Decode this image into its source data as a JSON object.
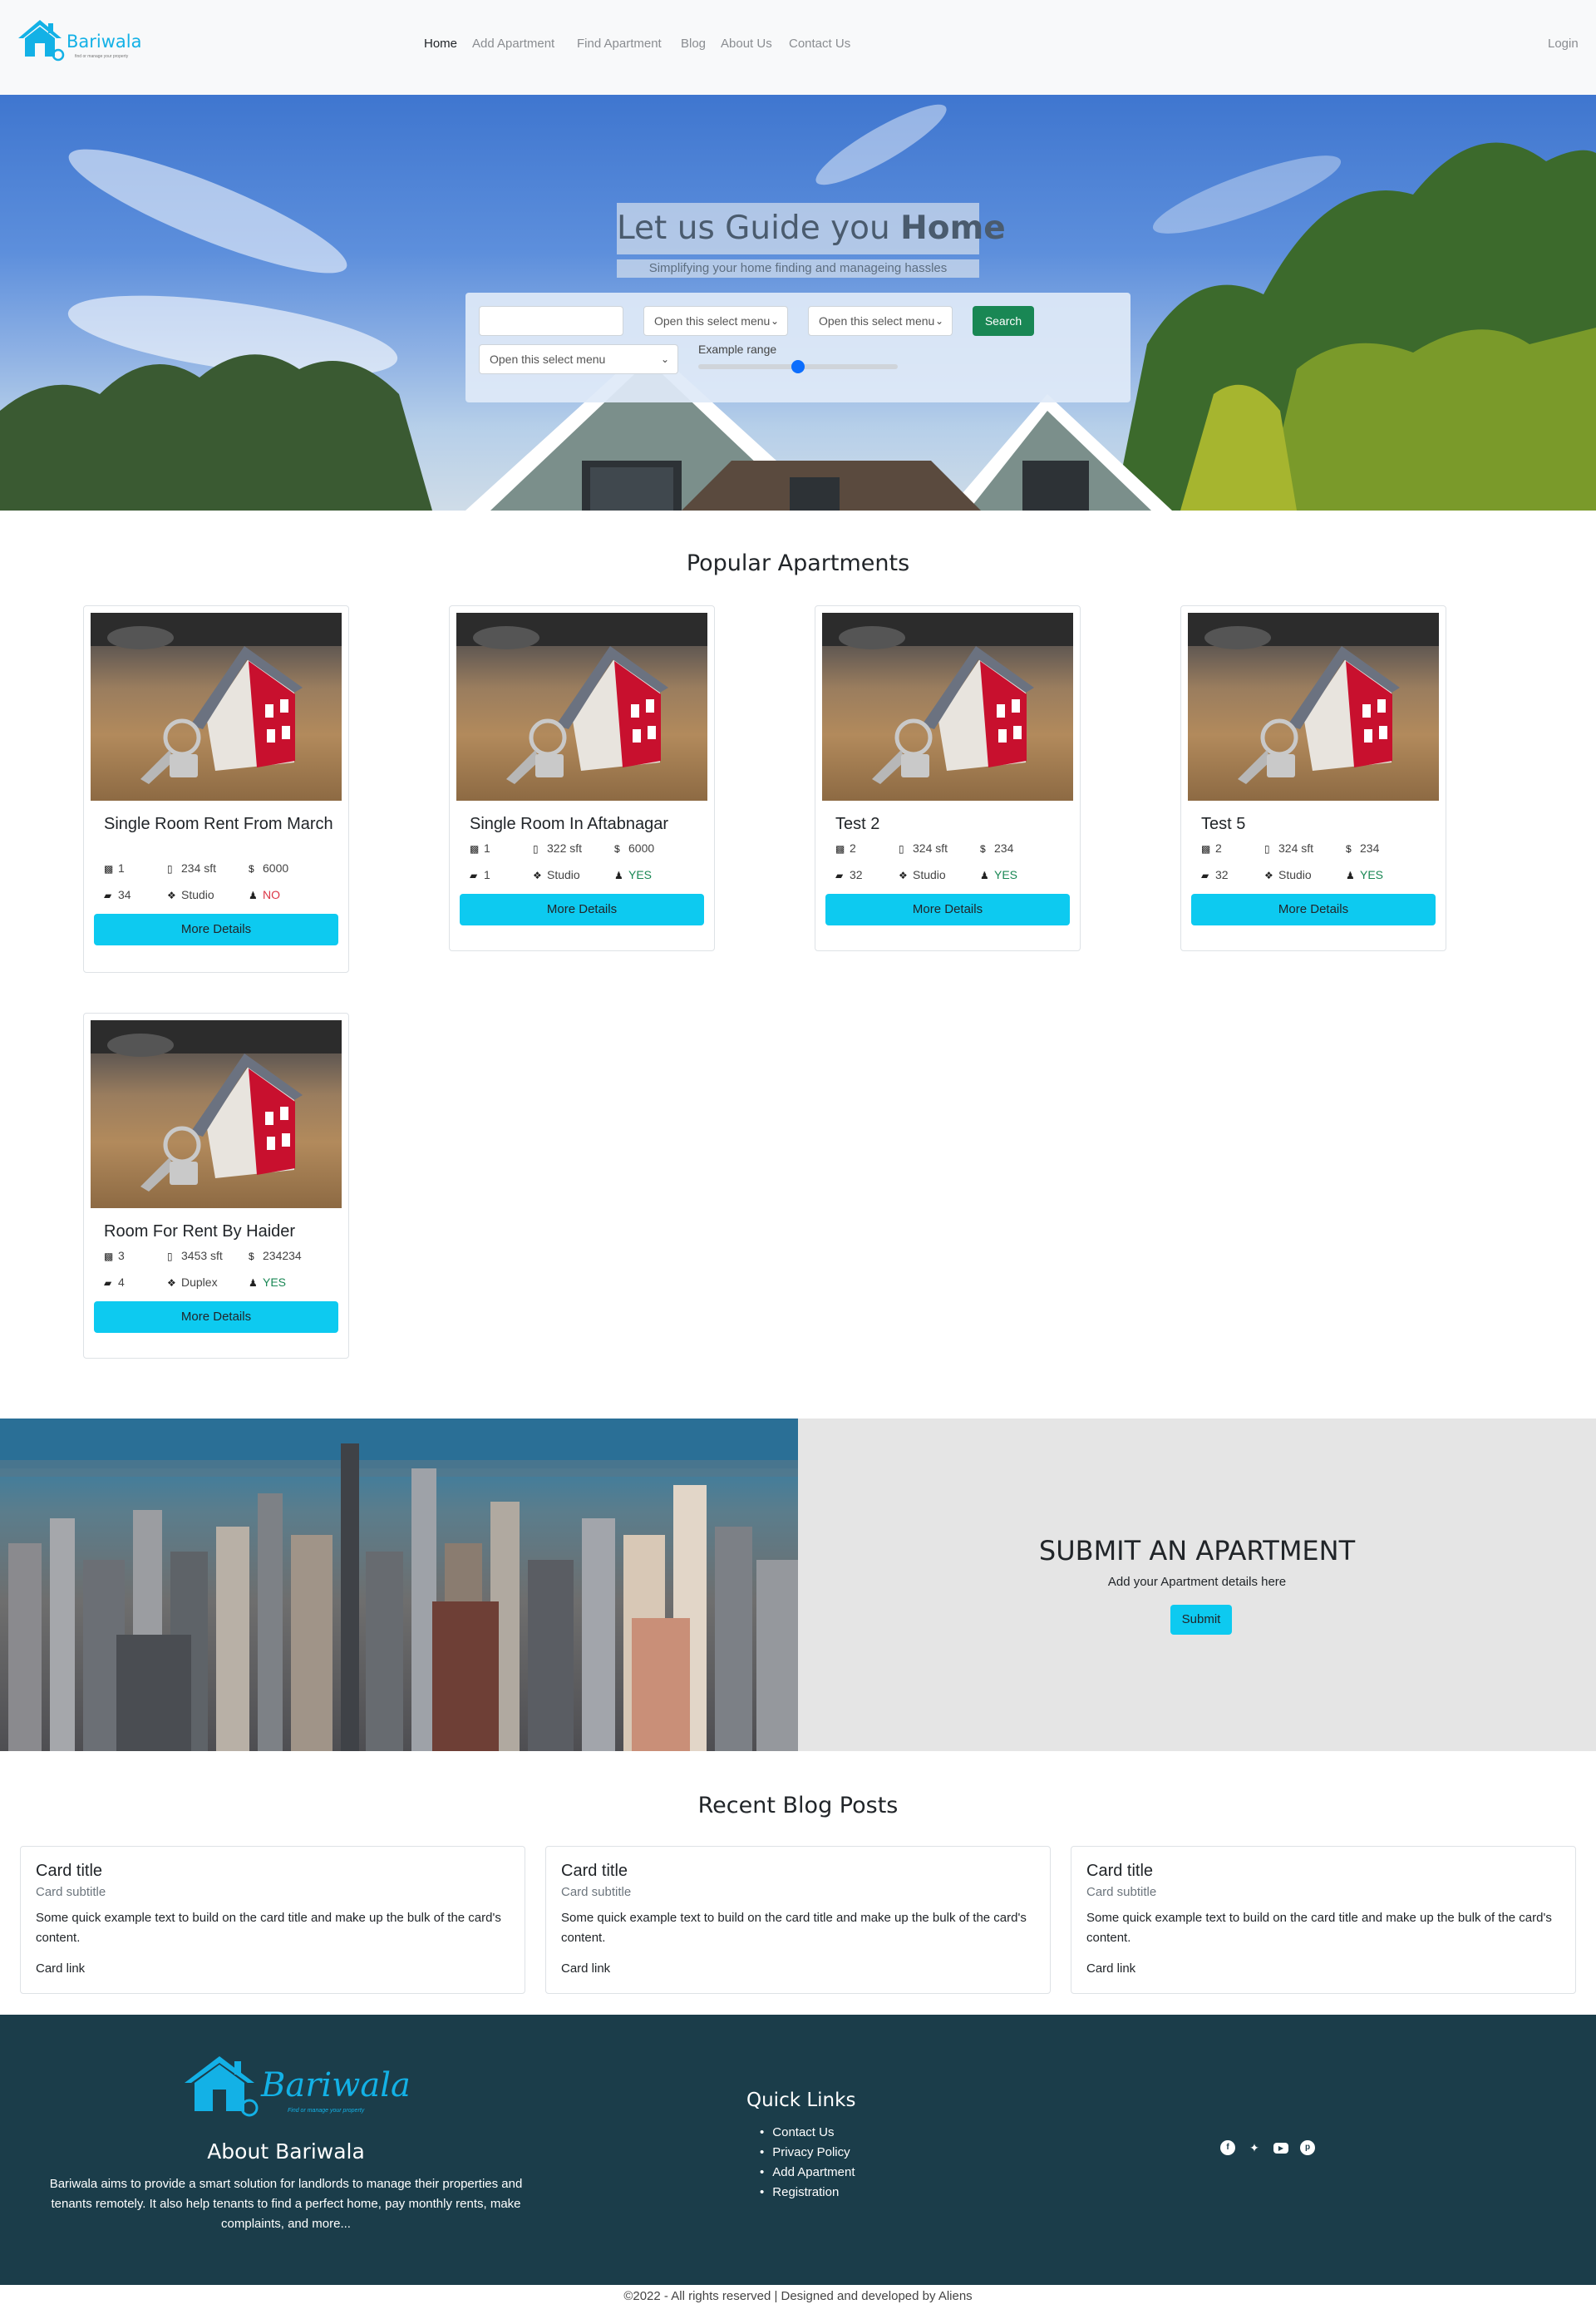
{
  "navbar": {
    "brand": "Bariwala",
    "brand_tagline": "find or manage your property",
    "links": [
      "Home",
      "Add Apartment",
      "Find Apartment",
      "Blog",
      "About Us",
      "Contact Us"
    ],
    "active_link": "Home",
    "login": "Login",
    "logo_icon": "house-icon"
  },
  "hero": {
    "title_main": "Let us Guide you ",
    "title_bold": "Home",
    "subtitle": "Simplifying your home finding and manageing hassles",
    "search": {
      "text_value": "",
      "select1": "Open this select menu",
      "select2": "Open this select menu",
      "select3": "Open this select menu",
      "button": "Search",
      "range_label": "Example range",
      "range_value_fraction": 0.5
    }
  },
  "popular": {
    "title": "Popular Apartments",
    "cards": [
      {
        "title": "Single Room Rent From March",
        "beds": "1",
        "area": "234 sft",
        "price": "6000",
        "baths": "34",
        "type": "Studio",
        "available": "NO"
      },
      {
        "title": "Single Room In Aftabnagar",
        "beds": "1",
        "area": "322 sft",
        "price": "6000",
        "baths": "1",
        "type": "Studio",
        "available": "YES"
      },
      {
        "title": "Test 2",
        "beds": "2",
        "area": "324 sft",
        "price": "234",
        "baths": "32",
        "type": "Studio",
        "available": "YES"
      },
      {
        "title": "Test 5",
        "beds": "2",
        "area": "324 sft",
        "price": "234",
        "baths": "32",
        "type": "Studio",
        "available": "YES"
      },
      {
        "title": "Room For Rent By Haider",
        "beds": "3",
        "area": "3453 sft",
        "price": "234234",
        "baths": "4",
        "type": "Duplex",
        "available": "YES"
      }
    ],
    "more_button": "More Details"
  },
  "submit": {
    "title": "SUBMIT AN APARTMENT",
    "subtitle": "Add your Apartment details here",
    "button": "Submit"
  },
  "blog": {
    "title": "Recent Blog Posts",
    "cards": [
      {
        "title": "Card title",
        "subtitle": "Card subtitle",
        "text": "Some quick example text to build on the card title and make up the bulk of the card's content.",
        "link": "Card link"
      },
      {
        "title": "Card title",
        "subtitle": "Card subtitle",
        "text": "Some quick example text to build on the card title and make up the bulk of the card's content.",
        "link": "Card link"
      },
      {
        "title": "Card title",
        "subtitle": "Card subtitle",
        "text": "Some quick example text to build on the card title and make up the bulk of the card's content.",
        "link": "Card link"
      }
    ]
  },
  "footer": {
    "logo": "Bariwala",
    "logo_tagline": "Find or manage your property",
    "about_title": "About Bariwala",
    "about_text": "Bariwala aims to provide a smart solution for landlords to manage their properties and tenants remotely. It also help tenants to find a perfect home, pay monthly rents, make complaints, and more...",
    "quick_links_title": "Quick Links",
    "quick_links": [
      "Contact Us",
      "Privacy Policy",
      "Add Apartment",
      "Registration"
    ],
    "social_icons": [
      "facebook-icon",
      "twitter-icon",
      "youtube-icon",
      "pinterest-icon"
    ],
    "copyright": "©2022 - All rights reserved | Designed and developed by Aliens"
  },
  "colors": {
    "brand": "#13b1e6",
    "info_button": "#0dcaf0",
    "success_button": "#198754",
    "footer_bg": "#1b3d4a",
    "danger": "#dc3545"
  }
}
